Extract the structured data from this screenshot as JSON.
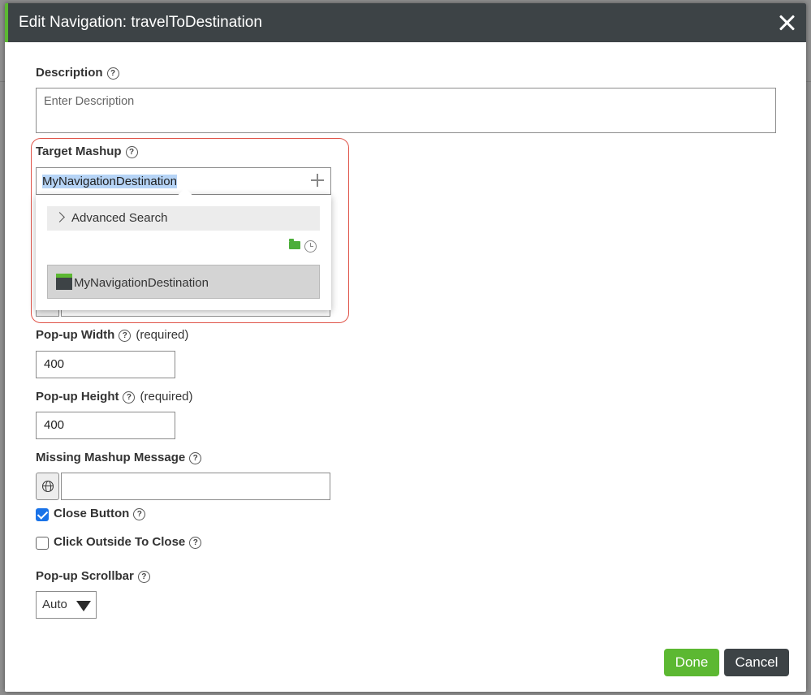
{
  "dialog": {
    "title": "Edit Navigation: travelToDestination"
  },
  "description": {
    "label": "Description",
    "placeholder": "Enter Description"
  },
  "target_mashup": {
    "label": "Target Mashup",
    "value": "MyNavigationDestination",
    "dropdown": {
      "advanced_search_label": "Advanced Search",
      "result_label": "MyNavigationDestination"
    }
  },
  "popup_width": {
    "label": "Pop-up Width",
    "required_label": "(required)",
    "value": "400"
  },
  "popup_height": {
    "label": "Pop-up Height",
    "required_label": "(required)",
    "value": "400"
  },
  "missing_mashup_message": {
    "label": "Missing Mashup Message",
    "value": ""
  },
  "close_button": {
    "label": "Close Button",
    "checked": true
  },
  "click_outside": {
    "label": "Click Outside To Close",
    "checked": false
  },
  "popup_scrollbar": {
    "label": "Pop-up Scrollbar",
    "selected": "Auto"
  },
  "footer": {
    "done_label": "Done",
    "cancel_label": "Cancel"
  },
  "colors": {
    "accent": "#5cb832",
    "titlebar": "#3d4346",
    "highlight": "#e0554a",
    "checkbox": "#1a73e8"
  },
  "icons": [
    "help-icon",
    "close-icon",
    "plus-icon",
    "chevron-right-icon",
    "folder-icon",
    "clock-icon",
    "mashup-icon",
    "globe-icon",
    "dropdown-arrow-icon"
  ]
}
